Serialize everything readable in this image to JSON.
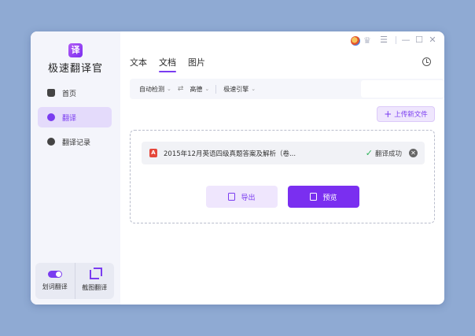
{
  "app": {
    "logo_glyph": "译",
    "title": "极速翻译官"
  },
  "sidebar": {
    "items": [
      {
        "label": "首页",
        "icon": "home-icon"
      },
      {
        "label": "翻译",
        "icon": "translate-icon",
        "active": true
      },
      {
        "label": "翻译记录",
        "icon": "history-icon"
      }
    ],
    "tools": [
      {
        "label": "划词翻译",
        "icon": "toggle-icon"
      },
      {
        "label": "截图翻译",
        "icon": "crop-icon"
      }
    ]
  },
  "titlebar": {
    "icons": [
      "avatar-icon",
      "vip-crown-icon",
      "menu-icon",
      "minimize-icon",
      "maximize-icon",
      "close-icon"
    ],
    "menu_glyph": "☰",
    "min_glyph": "—",
    "max_glyph": "☐",
    "close_glyph": "✕",
    "crown_glyph": "♛"
  },
  "tabs": [
    {
      "label": "文本"
    },
    {
      "label": "文档",
      "active": true
    },
    {
      "label": "图片"
    }
  ],
  "langbar": {
    "source": "自动检测",
    "swap_glyph": "⇄",
    "target": "高德",
    "engine": "极速引擎",
    "chevron": "⌄"
  },
  "upload": {
    "label": "上传新文件",
    "plus": "+"
  },
  "file": {
    "icon_glyph": "A",
    "name": "2015年12月英语四级真题答案及解析（卷...",
    "status": "翻译成功",
    "check_glyph": "✓",
    "remove_glyph": "✕"
  },
  "actions": {
    "export_label": "导出",
    "preview_label": "预览"
  },
  "colors": {
    "accent": "#7a2ff0",
    "accent_light": "#efe6fd",
    "background": "#8faad3",
    "success": "#2fb45a",
    "pdf": "#e5473b"
  }
}
